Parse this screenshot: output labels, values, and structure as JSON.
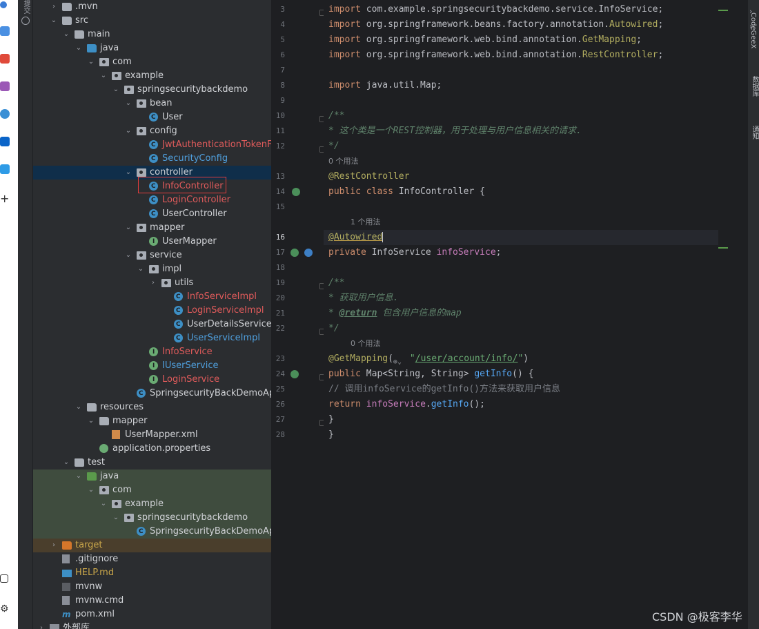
{
  "left_strip": {
    "icons": [
      "search-icon",
      "paint-icon",
      "toolbox-icon",
      "puzzle-icon",
      "plugin-icon",
      "outlook-icon",
      "send-icon",
      "add-icon",
      "debug-icon",
      "settings-icon"
    ]
  },
  "tool_sidebar": {
    "label": "提交"
  },
  "project_tree": {
    "rows": [
      {
        "label": ".mvn",
        "icon": "folder",
        "indent": 0,
        "arrow": "›"
      },
      {
        "label": "src",
        "icon": "folder",
        "indent": 0,
        "arrow": "⌄"
      },
      {
        "label": "main",
        "icon": "folder",
        "indent": 1,
        "arrow": "⌄"
      },
      {
        "label": "java",
        "icon": "folder-blue",
        "indent": 2,
        "arrow": "⌄"
      },
      {
        "label": "com",
        "icon": "package",
        "indent": 3,
        "arrow": "⌄"
      },
      {
        "label": "example",
        "icon": "package",
        "indent": 4,
        "arrow": "⌄"
      },
      {
        "label": "springsecuritybackdemo",
        "icon": "package",
        "indent": 5,
        "arrow": "⌄"
      },
      {
        "label": "bean",
        "icon": "package",
        "indent": 6,
        "arrow": "⌄"
      },
      {
        "label": "User",
        "icon": "class",
        "indent": 7,
        "arrow": ""
      },
      {
        "label": "config",
        "icon": "package",
        "indent": 6,
        "arrow": "⌄"
      },
      {
        "label": "JwtAuthenticationTokenFilte",
        "icon": "class",
        "indent": 7,
        "arrow": "",
        "color": "red"
      },
      {
        "label": "SecurityConfig",
        "icon": "class",
        "indent": 7,
        "arrow": "",
        "color": "blue"
      },
      {
        "label": "controller",
        "icon": "package",
        "indent": 6,
        "arrow": "⌄",
        "selected": true
      },
      {
        "label": "InfoController",
        "icon": "class",
        "indent": 7,
        "arrow": "",
        "color": "red"
      },
      {
        "label": "LoginController",
        "icon": "class",
        "indent": 7,
        "arrow": "",
        "color": "red"
      },
      {
        "label": "UserController",
        "icon": "class",
        "indent": 7,
        "arrow": ""
      },
      {
        "label": "mapper",
        "icon": "package",
        "indent": 6,
        "arrow": "⌄"
      },
      {
        "label": "UserMapper",
        "icon": "interface",
        "indent": 7,
        "arrow": ""
      },
      {
        "label": "service",
        "icon": "package",
        "indent": 6,
        "arrow": "⌄"
      },
      {
        "label": "impl",
        "icon": "package",
        "indent": 7,
        "arrow": "⌄"
      },
      {
        "label": "utils",
        "icon": "package",
        "indent": 8,
        "arrow": "›"
      },
      {
        "label": "InfoServiceImpl",
        "icon": "class",
        "indent": 9,
        "arrow": "",
        "color": "red"
      },
      {
        "label": "LoginServiceImpl",
        "icon": "class",
        "indent": 9,
        "arrow": "",
        "color": "red"
      },
      {
        "label": "UserDetailsServiceImpl",
        "icon": "class",
        "indent": 9,
        "arrow": ""
      },
      {
        "label": "UserServiceImpl",
        "icon": "class",
        "indent": 9,
        "arrow": "",
        "color": "blue"
      },
      {
        "label": "InfoService",
        "icon": "interface",
        "indent": 7,
        "arrow": "",
        "color": "red"
      },
      {
        "label": "IUserService",
        "icon": "interface",
        "indent": 7,
        "arrow": "",
        "color": "blue"
      },
      {
        "label": "LoginService",
        "icon": "interface",
        "indent": 7,
        "arrow": "",
        "color": "red"
      },
      {
        "label": "SpringsecurityBackDemoAppli",
        "icon": "class",
        "indent": 6,
        "arrow": ""
      },
      {
        "label": "resources",
        "icon": "folder",
        "indent": 2,
        "arrow": "⌄"
      },
      {
        "label": "mapper",
        "icon": "folder",
        "indent": 3,
        "arrow": "⌄"
      },
      {
        "label": "UserMapper.xml",
        "icon": "xml",
        "indent": 4,
        "arrow": ""
      },
      {
        "label": "application.properties",
        "icon": "props",
        "indent": 3,
        "arrow": ""
      },
      {
        "label": "test",
        "icon": "folder",
        "indent": 1,
        "arrow": "⌄"
      },
      {
        "label": "java",
        "icon": "folder-green",
        "indent": 2,
        "arrow": "⌄",
        "test": true
      },
      {
        "label": "com",
        "icon": "package",
        "indent": 3,
        "arrow": "⌄",
        "test": true
      },
      {
        "label": "example",
        "icon": "package",
        "indent": 4,
        "arrow": "⌄",
        "test": true
      },
      {
        "label": "springsecuritybackdemo",
        "icon": "package",
        "indent": 5,
        "arrow": "⌄",
        "test": true
      },
      {
        "label": "SpringsecurityBackDemoAppli",
        "icon": "class",
        "indent": 6,
        "arrow": "",
        "test": true
      },
      {
        "label": "target",
        "icon": "folder-orange",
        "indent": 0,
        "arrow": "›",
        "color": "olive",
        "target": true
      },
      {
        "label": ".gitignore",
        "icon": "file",
        "indent": 0,
        "arrow": ""
      },
      {
        "label": "HELP.md",
        "icon": "md",
        "indent": 0,
        "arrow": "",
        "color": "olive"
      },
      {
        "label": "mvnw",
        "icon": "mvnw",
        "indent": 0,
        "arrow": ""
      },
      {
        "label": "mvnw.cmd",
        "icon": "file",
        "indent": 0,
        "arrow": ""
      },
      {
        "label": "pom.xml",
        "icon": "pom",
        "indent": 0,
        "arrow": ""
      },
      {
        "label": "外部库",
        "icon": "library",
        "indent": -1,
        "arrow": "›"
      }
    ]
  },
  "editor": {
    "lines": [
      {
        "num": "3",
        "html": "<span class=\"kw\">import</span> com.example.springsecuritybackdemo.service.InfoService;"
      },
      {
        "num": "4",
        "html": "<span class=\"kw\">import</span> org.springframework.beans.factory.annotation.<span class=\"ann\">Autowired</span>;"
      },
      {
        "num": "5",
        "html": "<span class=\"kw\">import</span> org.springframework.web.bind.annotation.<span class=\"ann\">GetMapping</span>;"
      },
      {
        "num": "6",
        "html": "<span class=\"kw\">import</span> org.springframework.web.bind.annotation.<span class=\"ann\">RestController</span>;"
      },
      {
        "num": "7",
        "html": ""
      },
      {
        "num": "8",
        "html": "<span class=\"kw\">import</span> java.util.Map;"
      },
      {
        "num": "9",
        "html": ""
      },
      {
        "num": "10",
        "html": "<span class=\"doc\">/**</span>"
      },
      {
        "num": "11",
        "html": "<span class=\"doc\"> * 这个类是一个REST控制器，用于处理与用户信息相关的请求.</span>"
      },
      {
        "num": "12",
        "html": "<span class=\"doc\"> */</span>"
      },
      {
        "num": "",
        "hint": "0 个用法"
      },
      {
        "num": "13",
        "html": "<span class=\"ann\">@RestController</span>"
      },
      {
        "num": "14",
        "html": "<span class=\"kw\">public class</span> InfoController {"
      },
      {
        "num": "15",
        "html": ""
      },
      {
        "num": "",
        "hint": "1 个用法",
        "indent": 1
      },
      {
        "num": "16",
        "html": "    <span class=\"ann warn-ul\">@Autowired</span><span class=\"caret\"></span>",
        "current": true
      },
      {
        "num": "17",
        "html": "    <span class=\"kw\">private</span> InfoService <span class=\"fld\">infoService</span>;"
      },
      {
        "num": "18",
        "html": ""
      },
      {
        "num": "19",
        "html": "    <span class=\"doc\">/**</span>"
      },
      {
        "num": "20",
        "html": "    <span class=\"doc\"> * 获取用户信息.</span>"
      },
      {
        "num": "21",
        "html": "    <span class=\"doc\"> * </span><span class=\"doctag\">@return</span><span class=\"doc\"> 包含用户信息的map</span>"
      },
      {
        "num": "22",
        "html": "    <span class=\"doc\"> */</span>"
      },
      {
        "num": "",
        "hint": "0 个用法",
        "indent": 1
      },
      {
        "num": "23",
        "html": "    <span class=\"ann\">@GetMapping</span>(<span class=\"globe\">⊕⌄</span><span class=\"str\">\"</span><span class=\"strul\">/user/account/info/</span><span class=\"str\">\"</span>)"
      },
      {
        "num": "24",
        "html": "    <span class=\"kw\">public</span> Map&lt;String, String&gt; <span class=\"fn\">getInfo</span>() {"
      },
      {
        "num": "25",
        "html": "        <span class=\"cmt\">// 调用infoService的getInfo()方法来获取用户信息</span>"
      },
      {
        "num": "26",
        "html": "        <span class=\"kw\">return</span> <span class=\"fld\">infoService</span>.<span class=\"fn\">getInfo</span>();"
      },
      {
        "num": "27",
        "html": "    }"
      },
      {
        "num": "28",
        "html": "}"
      }
    ]
  },
  "right_tools": {
    "codegeex": "CodeGeeX",
    "database": "数据库",
    "notifications": "通知"
  },
  "watermark": "CSDN @极客李华"
}
